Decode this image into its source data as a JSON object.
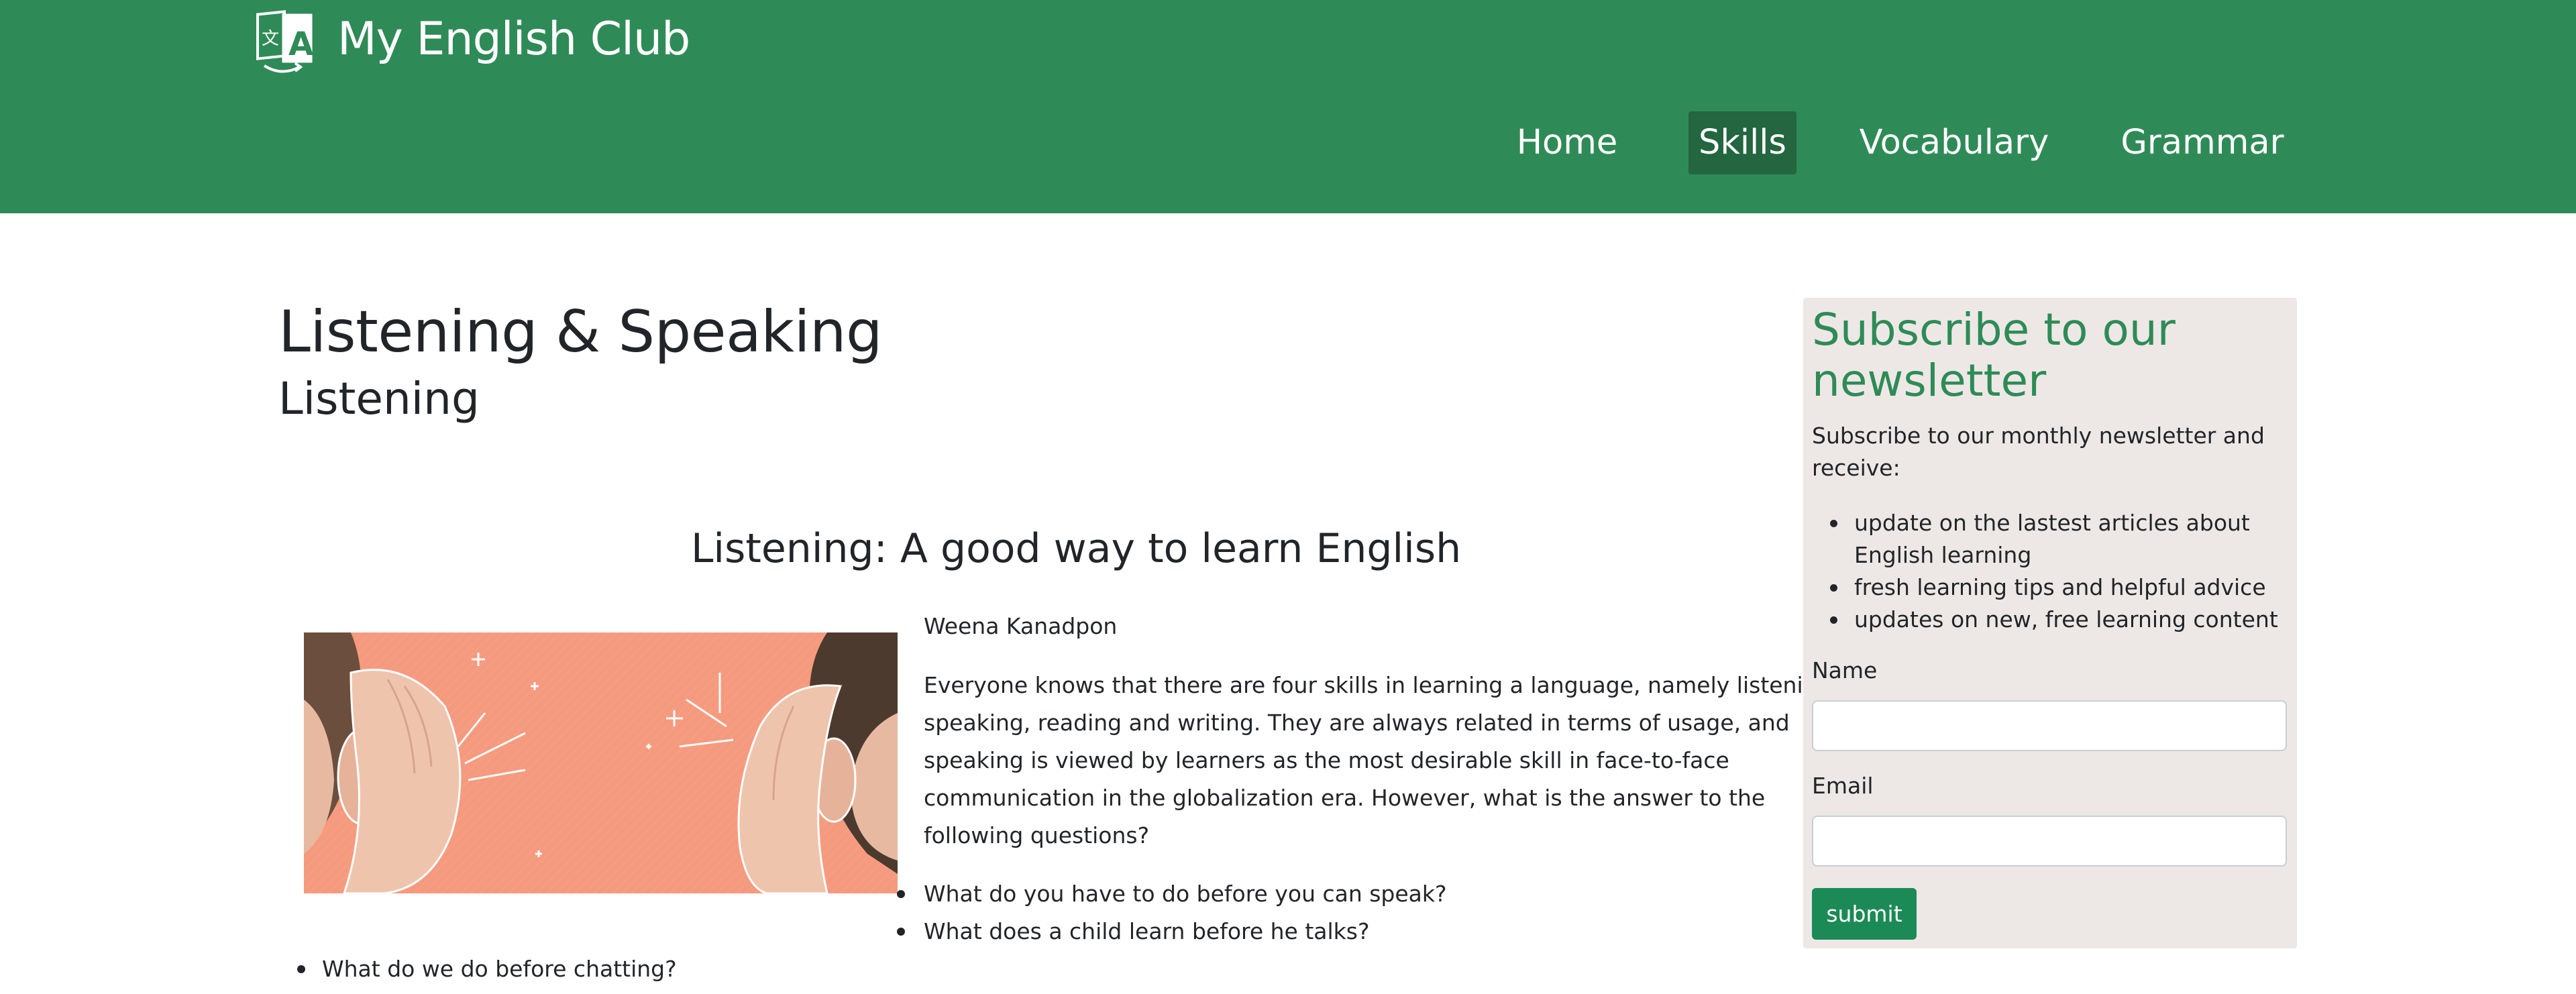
{
  "header": {
    "site_title": "My English Club",
    "logo_icon": "language-translate-icon",
    "brand_color": "#2e8b57",
    "nav": [
      {
        "label": "Home",
        "active": false
      },
      {
        "label": "Skills",
        "active": true
      },
      {
        "label": "Vocabulary",
        "active": false
      },
      {
        "label": "Grammar",
        "active": false
      }
    ]
  },
  "main": {
    "page_title": "Listening & Speaking",
    "sub_title": "Listening",
    "article": {
      "title": "Listening: A good way to learn English",
      "image_icon": "listening-ears-image",
      "author": "Weena Kanadpon",
      "paragraph_lines": [
        "Everyone knows that there are four skills in learning a language, namely listening,",
        "speaking, reading and writing. They are always related in terms of usage, and",
        "speaking is viewed by learners as the most desirable skill in face-to-face",
        "communication in the globalization era. However, what is the answer to the",
        "following questions?"
      ],
      "questions": [
        "What do you have to do before you can speak?",
        "What does a child learn before he talks?",
        "What do we do before chatting?"
      ]
    }
  },
  "sidebar": {
    "title": "Subscribe to our newsletter",
    "intro": "Subscribe to our monthly newsletter and receive:",
    "benefits": [
      "update on the lastest articles about English learning",
      "fresh learning tips and helpful advice",
      "updates on new, free learning content"
    ],
    "name_label": "Name",
    "name_value": "",
    "email_label": "Email",
    "email_value": "",
    "submit_label": "submit",
    "accent_color": "#2e8b57",
    "button_color": "#1b8a56",
    "background_color": "#ede8e6"
  }
}
